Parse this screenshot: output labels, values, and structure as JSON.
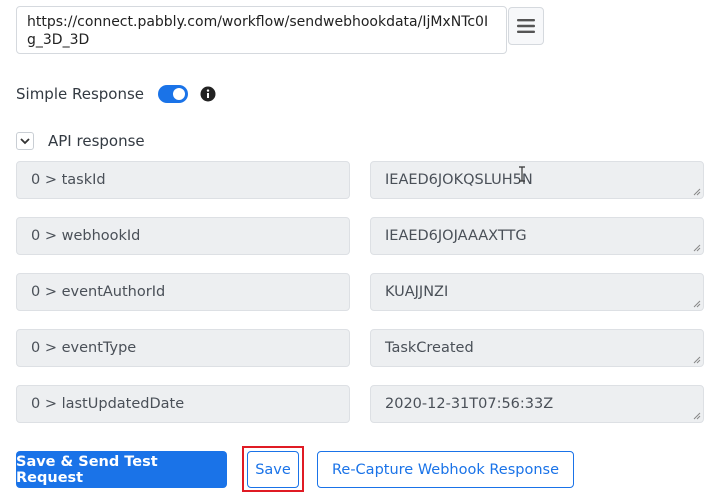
{
  "webhook": {
    "url": "https://connect.pabbly.com/workflow/sendwebhookdata/IjMxNTc0Ig_3D_3D",
    "menu_icon": "hamburger-menu-icon"
  },
  "simple_response": {
    "label": "Simple Response",
    "enabled": true,
    "info_icon": "info-icon"
  },
  "api_response": {
    "label": "API response",
    "fields": [
      {
        "key": "0 > taskId",
        "value": "IEAED6JOKQSLUH5N"
      },
      {
        "key": "0 > webhookId",
        "value": "IEAED6JOJAAAXTTG"
      },
      {
        "key": "0 > eventAuthorId",
        "value": "KUAJJNZI"
      },
      {
        "key": "0 > eventType",
        "value": "TaskCreated"
      },
      {
        "key": "0 > lastUpdatedDate",
        "value": "2020-12-31T07:56:33Z"
      }
    ]
  },
  "actions": {
    "save_send_label": "Save & Send Test Request",
    "save_label": "Save",
    "recapture_label": "Re-Capture Webhook Response"
  },
  "colors": {
    "accent": "#1a73e8",
    "highlight": "#e01b24",
    "field_bg": "#edeff1"
  }
}
